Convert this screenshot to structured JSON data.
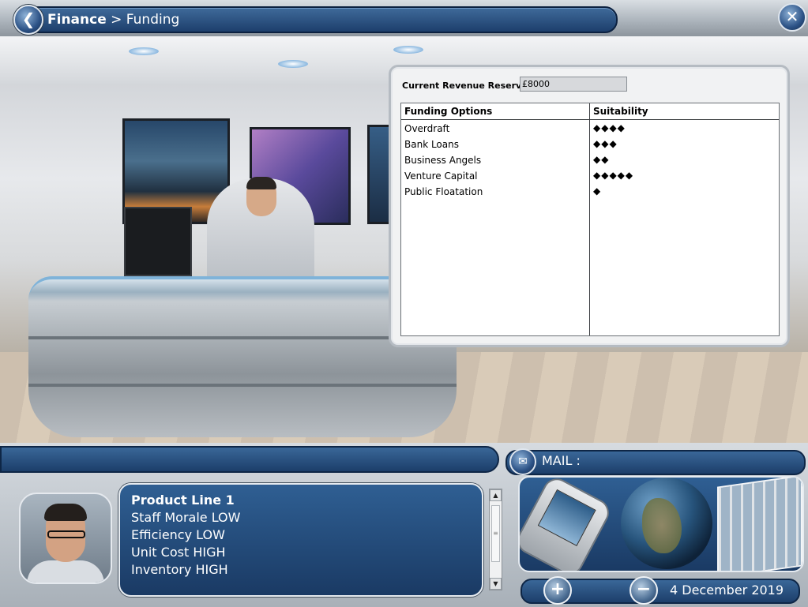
{
  "header": {
    "breadcrumb_section": "Finance",
    "breadcrumb_separator": " > ",
    "breadcrumb_page": "Funding",
    "back_icon": "back-arrow-icon",
    "close_icon": "close-x-icon"
  },
  "funding_panel": {
    "reserves_label": "Current Revenue Reserves",
    "reserves_value": "£8000",
    "columns": [
      "Funding Options",
      "Suitability"
    ],
    "rows": [
      {
        "option": "Overdraft",
        "suitability": "◆◆◆◆",
        "rating": 4
      },
      {
        "option": "Bank Loans",
        "suitability": "◆◆◆",
        "rating": 3
      },
      {
        "option": "Business Angels",
        "suitability": "◆◆",
        "rating": 2
      },
      {
        "option": "Venture Capital",
        "suitability": "◆◆◆◆◆",
        "rating": 5
      },
      {
        "option": "Public Floatation",
        "suitability": "◆",
        "rating": 1
      }
    ]
  },
  "message": {
    "title": "Product Line 1",
    "lines": [
      "Staff Morale LOW",
      "Efficiency LOW",
      "Unit Cost HIGH",
      "Inventory HIGH"
    ]
  },
  "mail": {
    "label": "MAIL :",
    "icon": "envelope-icon"
  },
  "footer": {
    "date": "4 December 2019",
    "zoom_in_icon": "plus-icon",
    "zoom_out_icon": "minus-icon"
  },
  "colors": {
    "panel_blue": "#1d3f6c",
    "panel_border": "#e6ebf0",
    "table_bg": "#ffffff"
  }
}
